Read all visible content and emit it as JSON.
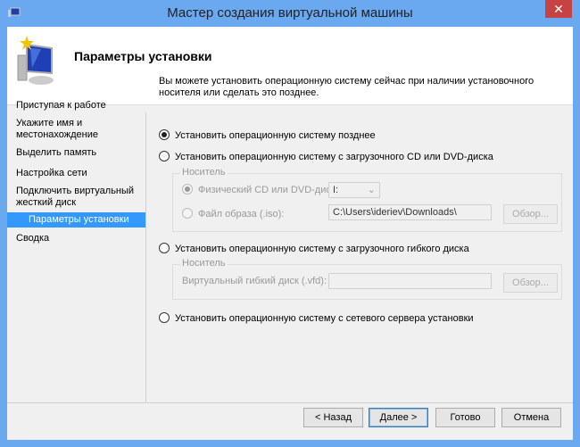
{
  "window": {
    "title": "Мастер создания виртуальной машины",
    "close": "✕"
  },
  "header": {
    "title": "Параметры установки"
  },
  "nav": {
    "items": [
      {
        "label": "Приступая к работе"
      },
      {
        "label": "Укажите имя и местонахождение"
      },
      {
        "label": "Выделить память"
      },
      {
        "label": "Настройка сети"
      },
      {
        "label": "Подключить виртуальный жесткий диск"
      },
      {
        "label": "Параметры установки"
      },
      {
        "label": "Сводка"
      }
    ]
  },
  "main": {
    "intro": "Вы можете установить операционную систему сейчас при наличии установочного носителя или сделать это позднее.",
    "opt_later": "Установить операционную систему позднее",
    "opt_cd": "Установить операционную систему с загрузочного CD или DVD-диска",
    "cd_group": "Носитель",
    "cd_physical": "Физический CD или DVD-диск:",
    "cd_drive": "I:",
    "cd_iso": "Файл образа (.iso):",
    "cd_iso_path": "C:\\Users\\ideriev\\Downloads\\",
    "browse": "Обзор...",
    "opt_floppy": "Установить операционную систему с загрузочного гибкого диска",
    "fl_group": "Носитель",
    "fl_label": "Виртуальный гибкий диск (.vfd):",
    "fl_path": "",
    "opt_network": "Установить операционную систему с сетевого сервера установки"
  },
  "buttons": {
    "back": "< Назад",
    "next": "Далее >",
    "finish": "Готово",
    "cancel": "Отмена"
  }
}
